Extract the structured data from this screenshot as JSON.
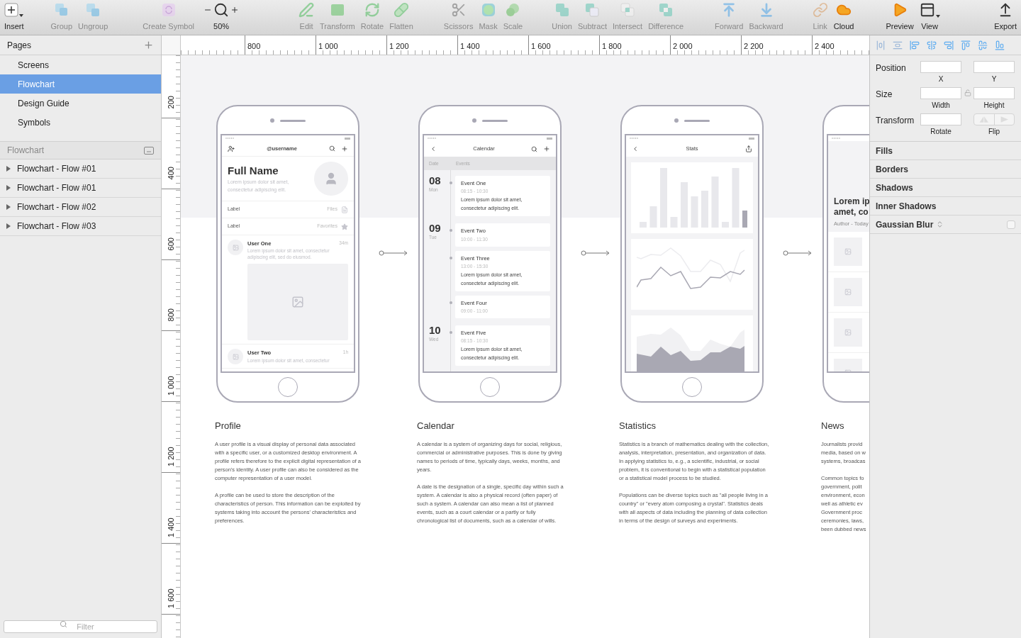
{
  "toolbar": {
    "groups": [
      {
        "items": [
          {
            "kind": "insert",
            "label": "Insert",
            "disabled": false
          }
        ]
      },
      {
        "items": [
          {
            "kind": "group",
            "label": "Group",
            "disabled": true
          },
          {
            "kind": "ungroup",
            "label": "Ungroup",
            "disabled": true
          }
        ]
      },
      {
        "items": [
          {
            "kind": "symbol",
            "label": "Create Symbol",
            "disabled": true
          }
        ]
      },
      {
        "items": [
          {
            "kind": "zoom",
            "label": "50%",
            "disabled": false
          }
        ]
      },
      {
        "items": [
          {
            "kind": "edit",
            "label": "Edit",
            "disabled": true
          },
          {
            "kind": "transform",
            "label": "Transform",
            "disabled": true
          },
          {
            "kind": "rotate",
            "label": "Rotate",
            "disabled": true
          },
          {
            "kind": "flatten",
            "label": "Flatten",
            "disabled": true
          }
        ]
      },
      {
        "items": [
          {
            "kind": "scissors",
            "label": "Scissors",
            "disabled": true
          },
          {
            "kind": "mask",
            "label": "Mask",
            "disabled": true
          },
          {
            "kind": "scale",
            "label": "Scale",
            "disabled": true
          }
        ]
      },
      {
        "items": [
          {
            "kind": "union",
            "label": "Union",
            "disabled": true
          },
          {
            "kind": "subtract",
            "label": "Subtract",
            "disabled": true
          },
          {
            "kind": "intersect",
            "label": "Intersect",
            "disabled": true
          },
          {
            "kind": "difference",
            "label": "Difference",
            "disabled": true
          }
        ]
      },
      {
        "items": [
          {
            "kind": "forward",
            "label": "Forward",
            "disabled": true
          },
          {
            "kind": "backward",
            "label": "Backward",
            "disabled": true
          }
        ]
      },
      {
        "items": [
          {
            "kind": "link",
            "label": "Link",
            "disabled": true
          },
          {
            "kind": "cloud",
            "label": "Cloud",
            "disabled": false
          }
        ]
      },
      {
        "items": [
          {
            "kind": "preview",
            "label": "Preview",
            "disabled": false
          },
          {
            "kind": "view",
            "label": "View",
            "disabled": false
          }
        ]
      },
      {
        "items": [
          {
            "kind": "export",
            "label": "Export",
            "disabled": false
          }
        ]
      }
    ]
  },
  "pages": {
    "title": "Pages",
    "items": [
      {
        "label": "Screens",
        "selected": false
      },
      {
        "label": "Flowchart",
        "selected": true
      },
      {
        "label": "Design Guide",
        "selected": false
      },
      {
        "label": "Symbols",
        "selected": false
      }
    ]
  },
  "layers": {
    "title": "Flowchart",
    "items": [
      {
        "label": "Flowchart - Flow #01",
        "expanded": false
      },
      {
        "label": "Flowchart - Flow #01",
        "expanded": false
      },
      {
        "label": "Flowchart - Flow #02",
        "expanded": false
      },
      {
        "label": "Flowchart - Flow #03",
        "expanded": false
      }
    ]
  },
  "filter": {
    "placeholder": "Filter"
  },
  "rulers": {
    "horizontal": [
      "800",
      "1 000",
      "1 200",
      "1 400",
      "1 600",
      "1 800",
      "2 000",
      "2 200",
      "2 400"
    ],
    "vertical": [
      "200",
      "400",
      "600",
      "800",
      "1 000",
      "1 200",
      "1 400",
      "1 600"
    ]
  },
  "artboards": [
    {
      "kind": "profile",
      "title": "Profile",
      "screen": {
        "header": "@username",
        "name": "Full Name",
        "bio": "Lorem ipsum dolor sit amet, consectetur adipiscing elit.",
        "rows": [
          {
            "label": "Label",
            "value": "Files",
            "kind": "file"
          },
          {
            "label": "Label",
            "value": "Favorites",
            "kind": "star"
          }
        ],
        "posts": [
          {
            "user": "User One",
            "time": "34m",
            "text": "Lorem ipsum dolor sit amet, consectetur adipiscing elit, sed do eiusmod.",
            "image": true
          },
          {
            "user": "User Two",
            "time": "1h",
            "text": "Lorem ipsum dolor sit amet, consectetur",
            "image": false
          }
        ]
      },
      "paragraphs": [
        "A user profile is a visual display of personal data associated with a specific user, or a customized desktop environment. A profile refers therefore to the explicit digital representation of a person's identity. A user profile can also be considered as the computer representation of a user model.",
        "A profile can be used to store the description of the characteristics of person. This information can be exploited by systems taking into account the persons' characteristics and preferences."
      ]
    },
    {
      "kind": "calendar",
      "title": "Calendar",
      "screen": {
        "header": "Calendar",
        "columns": [
          "Date",
          "Events"
        ],
        "days": [
          {
            "day": "08",
            "weekday": "Mon",
            "events": [
              {
                "title": "Event One",
                "time": "08:15 - 10:30",
                "text": "Lorem ipsum dolor sit amet, consectetur adipiscing elit."
              }
            ]
          },
          {
            "day": "09",
            "weekday": "Tue",
            "events": [
              {
                "title": "Event Two",
                "time": "10:00 - 11:30"
              },
              {
                "title": "Event Three",
                "time": "13:00 - 15:30",
                "text": "Lorem ipsum dolor sit amet, consectetur adipiscing elit."
              },
              {
                "title": "Event Four",
                "time": "09:00 - 11:00"
              }
            ]
          },
          {
            "day": "10",
            "weekday": "Wed",
            "events": [
              {
                "title": "Event Five",
                "time": "08:15 - 10:30",
                "text": "Lorem ipsum dolor sit amet, consectetur adipiscing elit."
              }
            ]
          }
        ]
      },
      "paragraphs": [
        "A calendar is a system of organizing days for social, religious, commercial or administrative purposes. This is done by giving names to periods of time, typically days, weeks, months, and years.",
        "A date is the designation of a single, specific day within such a system. A calendar is also a physical record (often paper) of such a system. A calendar can also mean a list of planned events, such as a court calendar or a partly or fully chronological list of documents, such as a calendar of wills."
      ]
    },
    {
      "kind": "stats",
      "title": "Statistics",
      "screen": {
        "header": "Stats"
      },
      "paragraphs": [
        "Statistics is a branch of mathematics dealing with the collection, analysis, interpretation, presentation, and organization of data. In applying statistics to, e.g., a scientific, industrial, or social problem, it is conventional to begin with a statistical population or a statistical model process to be studied.",
        "Populations can be diverse topics such as \"all people living in a country\" or \"every atom composing a crystal\". Statistics deals with all aspects of data including the planning of data collection in terms of the design of surveys and experiments."
      ]
    },
    {
      "kind": "news",
      "title": "News",
      "screen": {
        "headline": [
          "Lorem ip",
          "amet, co"
        ],
        "meta": "Author - Today"
      },
      "paragraphs": [
        [
          "Journalists provid",
          "media, based on w",
          "systems, broadcas"
        ],
        [
          "Common topics fo",
          "government, polit",
          "environment, econ",
          "well as athletic ev",
          "Government proc",
          "ceremonies, laws,",
          "been dubbed news"
        ]
      ]
    }
  ],
  "inspector": {
    "rows": [
      {
        "label": "Position",
        "fields": [
          {
            "kind": "text",
            "caption": "X"
          },
          {
            "kind": "text",
            "caption": "Y"
          }
        ]
      },
      {
        "label": "Size",
        "locked": false,
        "fields": [
          {
            "kind": "text",
            "caption": "Width"
          },
          {
            "kind": "text",
            "caption": "Height"
          }
        ]
      },
      {
        "label": "Transform",
        "fields": [
          {
            "kind": "text",
            "caption": "Rotate"
          },
          {
            "kind": "flip",
            "caption": "Flip"
          }
        ]
      }
    ],
    "sections": [
      {
        "kind": "plain",
        "label": "Fills"
      },
      {
        "kind": "plain",
        "label": "Borders"
      },
      {
        "kind": "plain",
        "label": "Shadows"
      },
      {
        "kind": "plain",
        "label": "Inner Shadows"
      },
      {
        "kind": "toggle",
        "label": "Gaussian Blur",
        "checked": false
      }
    ]
  }
}
